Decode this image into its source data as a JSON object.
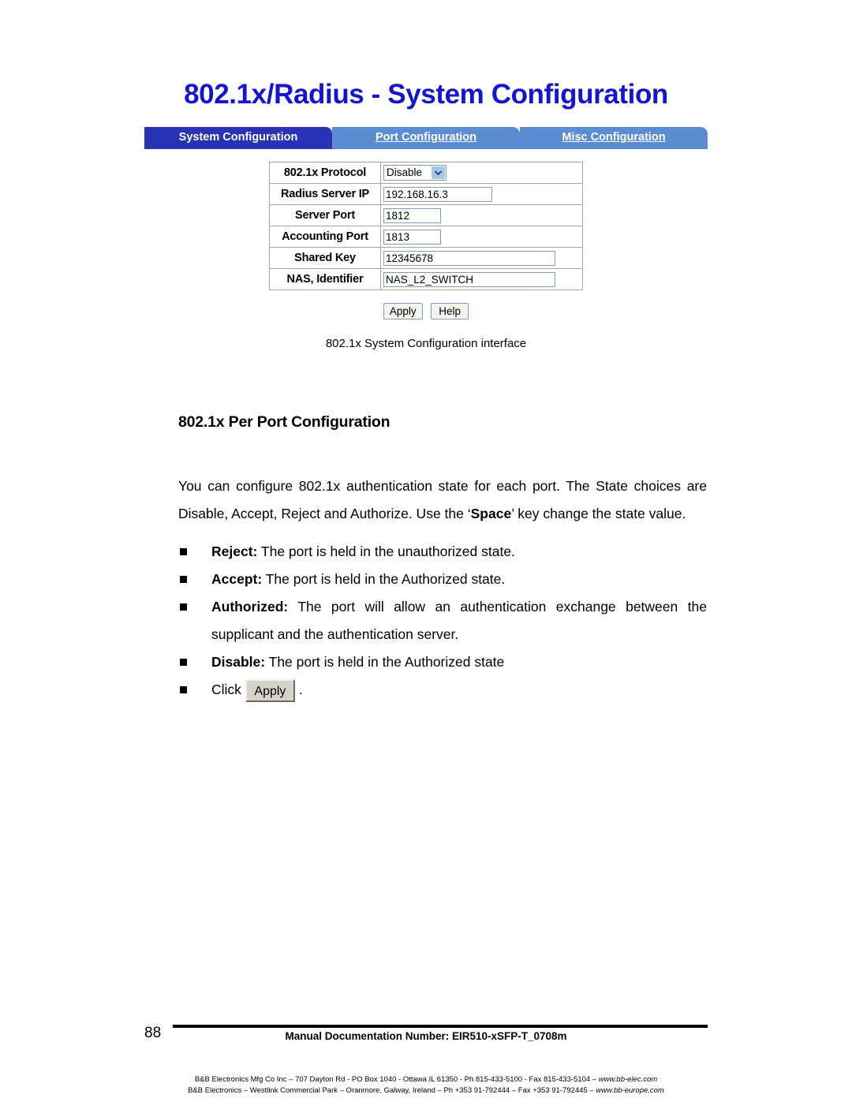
{
  "figure": {
    "screen_title": "802.1x/Radius - System Configuration",
    "tabs": [
      {
        "label": "System Configuration",
        "active": true
      },
      {
        "label": "Port Configuration",
        "active": false
      },
      {
        "label": "Misc Configuration",
        "active": false
      }
    ],
    "form_rows": [
      {
        "label": "802.1x Protocol",
        "value": "Disable",
        "control": "select"
      },
      {
        "label": "Radius Server IP",
        "value": "192.168.16.3",
        "control": "text"
      },
      {
        "label": "Server Port",
        "value": "1812",
        "control": "text"
      },
      {
        "label": "Accounting Port",
        "value": "1813",
        "control": "text"
      },
      {
        "label": "Shared Key",
        "value": "12345678",
        "control": "text"
      },
      {
        "label": "NAS, Identifier",
        "value": "NAS_L2_SWITCH",
        "control": "text"
      }
    ],
    "buttons": {
      "apply": "Apply",
      "help": "Help"
    },
    "caption": "802.1x System Configuration interface",
    "colors": {
      "title_blue": "#1414d2",
      "tab_active": "#2832b4",
      "tab_inactive": "#5b8bd0",
      "input_border": "#7f9db9",
      "select_arrow_bg": "#a8c6e8"
    }
  },
  "content": {
    "heading": "802.1x Per Port Configuration",
    "paragraph": {
      "part1": "You can configure 802.1x authentication state for each port. The State choices are Disable, Accept, Reject and Authorize. Use the ‘",
      "bold": "Space",
      "part2": "’ key change the state value."
    },
    "bullets": [
      {
        "term": "Reject:",
        "text": " The port is held in the unauthorized state."
      },
      {
        "term": "Accept:",
        "text": " The port is held in the Authorized state."
      },
      {
        "term": "Authorized:",
        "text": " The port will allow an authentication exchange between the supplicant and the authentication server."
      },
      {
        "term": "Disable:",
        "text": " The port is held in the Authorized state"
      }
    ],
    "click_bullet": {
      "prefix": "Click",
      "button_label": "Apply",
      "suffix": "."
    }
  },
  "footer": {
    "page_number": "88",
    "doc_number": "Manual Documentation Number: EIR510-xSFP-T_0708m",
    "address_line1_pre": "B&B Electronics Mfg Co Inc – 707 Dayton Rd - PO Box 1040 - Ottawa IL 61350 - Ph 815-433-5100 - Fax 815-433-5104 – ",
    "address_line1_url": "www.bb-elec.com",
    "address_line2_pre": "B&B Electronics – Westlink Commercial Park – Oranmore, Galway, Ireland – Ph +353 91-792444 – Fax +353 91-792445 – ",
    "address_line2_url": "www.bb-europe.com"
  }
}
